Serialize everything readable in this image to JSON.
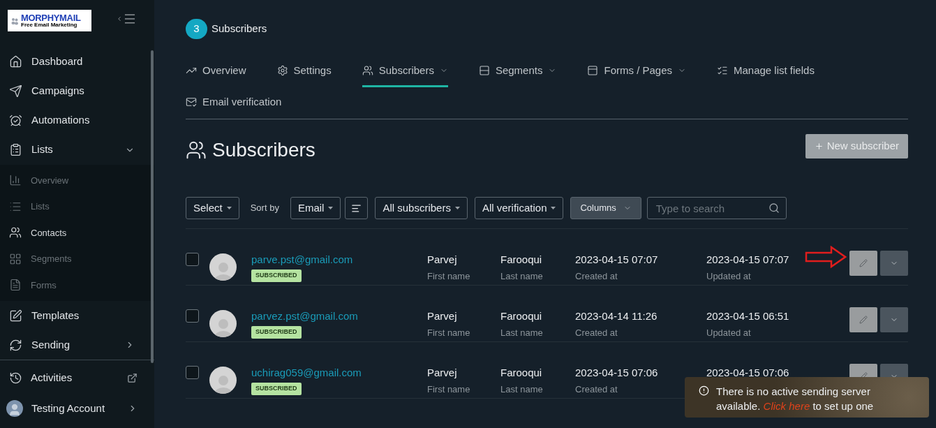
{
  "logo": {
    "name": "MORPHYMAIL",
    "tagline": "Free Email Marketing"
  },
  "sidebar": {
    "items": [
      {
        "label": "Dashboard"
      },
      {
        "label": "Campaigns"
      },
      {
        "label": "Automations"
      },
      {
        "label": "Lists",
        "expanded": true,
        "children": [
          {
            "label": "Overview",
            "selected": false
          },
          {
            "label": "Lists",
            "selected": false
          },
          {
            "label": "Contacts",
            "selected": true
          },
          {
            "label": "Segments",
            "selected": false
          },
          {
            "label": "Forms",
            "selected": false
          }
        ]
      },
      {
        "label": "Templates"
      },
      {
        "label": "Sending",
        "expanded": false
      }
    ],
    "footer": [
      {
        "kind": "link",
        "label": "Activities"
      },
      {
        "kind": "account",
        "label": "Testing Account"
      }
    ]
  },
  "header": {
    "count": "3",
    "title": "Subscribers"
  },
  "tabs": [
    {
      "label": "Overview",
      "selected": false,
      "dropdown": false
    },
    {
      "label": "Settings",
      "selected": false,
      "dropdown": false
    },
    {
      "label": "Subscribers",
      "selected": true,
      "dropdown": true
    },
    {
      "label": "Segments",
      "selected": false,
      "dropdown": true
    },
    {
      "label": "Forms / Pages",
      "selected": false,
      "dropdown": true
    },
    {
      "label": "Manage list fields",
      "selected": false,
      "dropdown": false
    },
    {
      "label": "Email verification",
      "selected": false,
      "dropdown": false
    }
  ],
  "heading": "Subscribers",
  "new_button": "New subscriber",
  "toolbar": {
    "select": "Select",
    "sort_label": "Sort by",
    "sort_field": "Email",
    "filters": [
      "All subscribers",
      "All verification"
    ],
    "columns": "Columns",
    "search_placeholder": "Type to search"
  },
  "rows": [
    {
      "checked": false,
      "email": "parve.pst@gmail.com",
      "status": "SUBSCRIBED",
      "first_name": "Parvej",
      "first_label": "First name",
      "last_name": "Farooqui",
      "last_label": "Last name",
      "created": "2023-04-15 07:07",
      "created_label": "Created at",
      "updated": "2023-04-15 07:07",
      "updated_label": "Updated at",
      "annotated": true
    },
    {
      "checked": false,
      "email": "parvez.pst@gmail.com",
      "status": "SUBSCRIBED",
      "first_name": "Parvej",
      "first_label": "First name",
      "last_name": "Farooqui",
      "last_label": "Last name",
      "created": "2023-04-14 11:26",
      "created_label": "Created at",
      "updated": "2023-04-15 06:51",
      "updated_label": "Updated at",
      "annotated": false
    },
    {
      "checked": false,
      "email": "uchirag059@gmail.com",
      "status": "SUBSCRIBED",
      "first_name": "Parvej",
      "first_label": "First name",
      "last_name": "Farooqui",
      "last_label": "Last name",
      "created": "2023-04-15 07:06",
      "created_label": "Created at",
      "updated": "2023-04-15 07:06",
      "annotated": false
    }
  ],
  "toast": {
    "text_before": "There is no active sending server available.",
    "link": "Click here",
    "text_after": "to set up one"
  }
}
